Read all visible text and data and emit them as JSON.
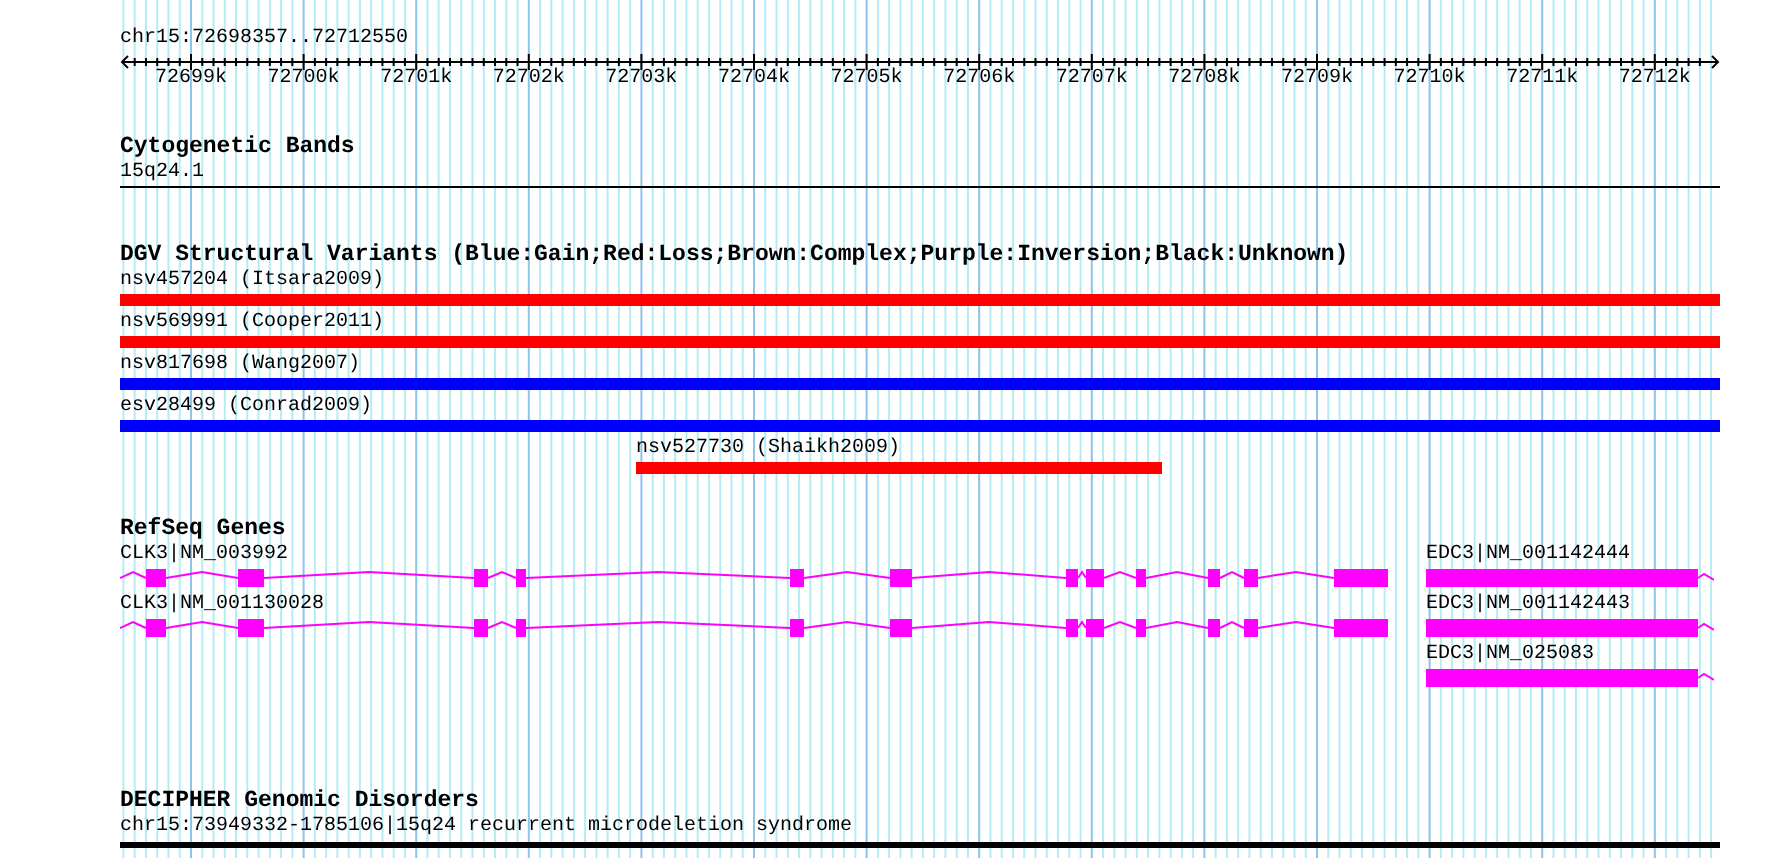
{
  "ruler": {
    "range": "chr15:72698357..72712550",
    "ticks": [
      "72699k",
      "72700k",
      "72701k",
      "72702k",
      "72703k",
      "72704k",
      "72705k",
      "72706k",
      "72707k",
      "72708k",
      "72709k",
      "72710k",
      "72711k",
      "72712k"
    ]
  },
  "cytogenetic_bands": {
    "title": "Cytogenetic Bands",
    "bands": [
      {
        "label": "15q24.1"
      }
    ]
  },
  "dgv_variants": {
    "title": "DGV Structural Variants (Blue:Gain;Red:Loss;Brown:Complex;Purple:Inversion;Black:Unknown)",
    "variants": [
      {
        "label": "nsv457204 (Itsara2009)",
        "color": "#ff0000"
      },
      {
        "label": "nsv569991 (Cooper2011)",
        "color": "#ff0000"
      },
      {
        "label": "nsv817698 (Wang2007)",
        "color": "#0000ff"
      },
      {
        "label": "esv28499 (Conrad2009)",
        "color": "#0000ff"
      },
      {
        "label": "nsv527730 (Shaikh2009)",
        "color": "#ff0000"
      }
    ]
  },
  "refseq_genes": {
    "title": "RefSeq Genes",
    "genes": [
      {
        "label": "CLK3|NM_003992"
      },
      {
        "label": "EDC3|NM_001142444"
      },
      {
        "label": "CLK3|NM_001130028"
      },
      {
        "label": "EDC3|NM_001142443"
      },
      {
        "label": "EDC3|NM_025083"
      }
    ]
  },
  "decipher": {
    "title": "DECIPHER Genomic Disorders",
    "disorders": [
      {
        "label": "chr15:73949332-1785106|15q24 recurrent microdeletion syndrome"
      }
    ]
  }
}
